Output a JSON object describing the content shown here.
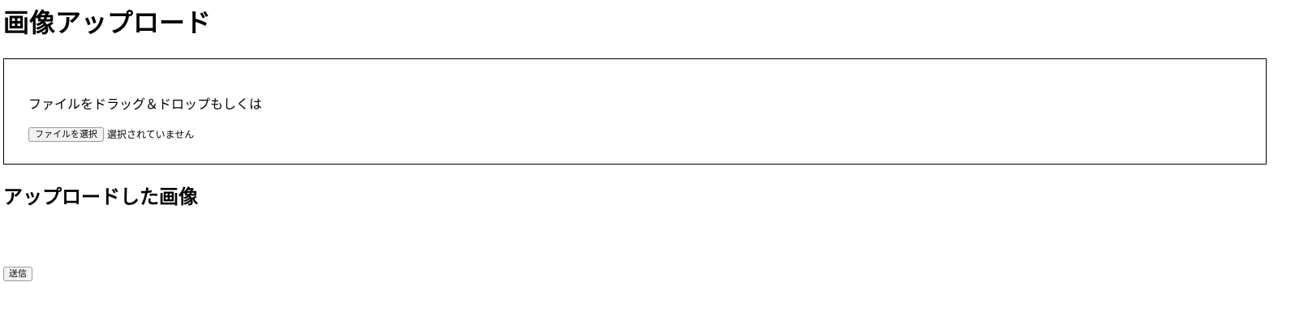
{
  "page": {
    "title": "画像アップロード"
  },
  "dropzone": {
    "instruction": "ファイルをドラッグ＆ドロップもしくは",
    "file_button_label": "ファイルを選択",
    "file_status": "選択されていません"
  },
  "uploaded": {
    "heading": "アップロードした画像"
  },
  "form": {
    "submit_label": "送信"
  }
}
